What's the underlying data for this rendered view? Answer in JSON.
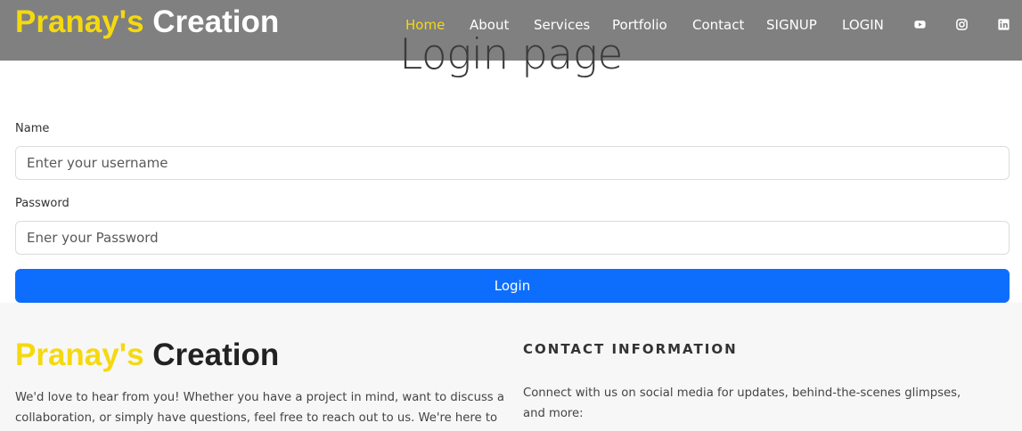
{
  "navbar": {
    "brand_first": "Pranay's",
    "brand_second": "Creation",
    "links": [
      {
        "label": "Home",
        "active": true
      },
      {
        "label": "About"
      },
      {
        "label": "Services"
      },
      {
        "label": "Portfolio"
      },
      {
        "label": "Contact"
      },
      {
        "label": "SIGNUP"
      },
      {
        "label": "LOGIN"
      }
    ],
    "social_icons": [
      "youtube-icon",
      "instagram-icon",
      "linkedin-icon"
    ]
  },
  "main": {
    "title": "Login page",
    "name_label": "Name",
    "name_placeholder": "Enter your username",
    "password_label": "Password",
    "password_placeholder": "Ener your Password",
    "login_button": "Login"
  },
  "footer": {
    "brand_first": "Pranay's",
    "brand_second": "Creation",
    "about_text": "We'd love to hear from you! Whether you have a project in mind, want to discuss a collaboration, or simply have questions, feel free to reach out to us. We're here to",
    "contact_heading": "CONTACT INFORMATION",
    "contact_text": "Connect with us on social media for updates, behind-the-scenes glimpses, and more:"
  },
  "colors": {
    "navbar_bg": "#808080",
    "brand_yellow": "#f5d90f",
    "button_blue": "#0d6efd",
    "footer_bg": "#f7f7f7"
  }
}
